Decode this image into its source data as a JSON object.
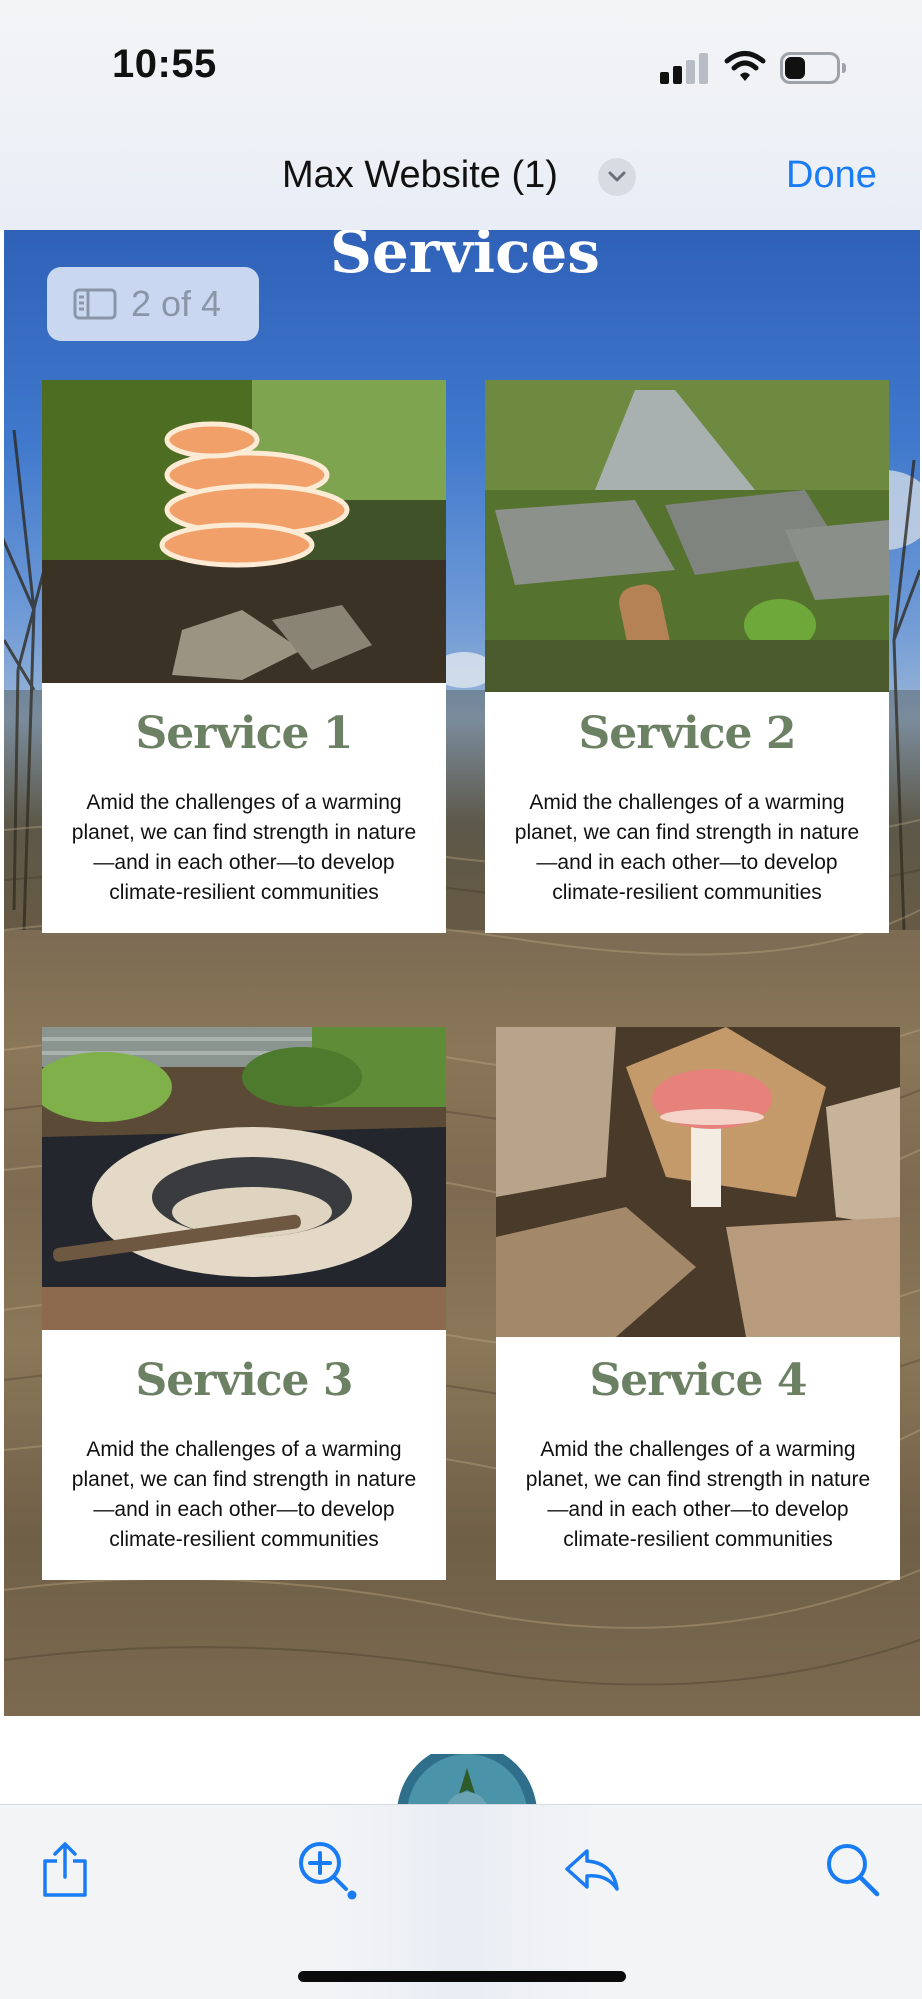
{
  "status_bar": {
    "time": "10:55",
    "signal_icon": "cellular-signal-icon",
    "wifi_icon": "wifi-icon",
    "battery_icon": "battery-icon"
  },
  "nav": {
    "title": "Max Website (1)",
    "chevron_icon": "chevron-down-icon",
    "done_label": "Done",
    "accent_color": "#1a7cf4"
  },
  "page_indicator": {
    "icon": "sidebar-icon",
    "text": "2 of 4"
  },
  "section": {
    "heading": "Services"
  },
  "services": [
    {
      "title": "Service 1",
      "photo": "orange shelf fungus on mossy tree",
      "lines": [
        "Amid the challenges of a warming",
        "planet, we can find strength in nature",
        "—and in each other—to develop",
        "climate-resilient communities"
      ]
    },
    {
      "title": "Service 2",
      "photo": "stream with rocks and ferns",
      "lines": [
        "Amid the challenges of a warming",
        "planet, we can find strength in nature",
        "—and in each other—to develop",
        "climate-resilient communities"
      ]
    },
    {
      "title": "Service 3",
      "photo": "pond construction with liner",
      "lines": [
        "Amid the challenges of a warming",
        "planet, we can find strength in nature",
        "—and in each other—to develop",
        "climate-resilient communities"
      ]
    },
    {
      "title": "Service 4",
      "photo": "pink mushroom in leaf litter",
      "lines": [
        "Amid the challenges of a warming",
        "planet, we can find strength in nature",
        "—and in each other—to develop",
        "climate-resilient communities"
      ]
    }
  ],
  "colors": {
    "card_title": "#6c8063"
  },
  "toolbar": {
    "share_icon": "share-icon",
    "zoom_icon": "zoom-in-icon",
    "reply_icon": "reply-icon",
    "search_icon": "search-icon"
  }
}
